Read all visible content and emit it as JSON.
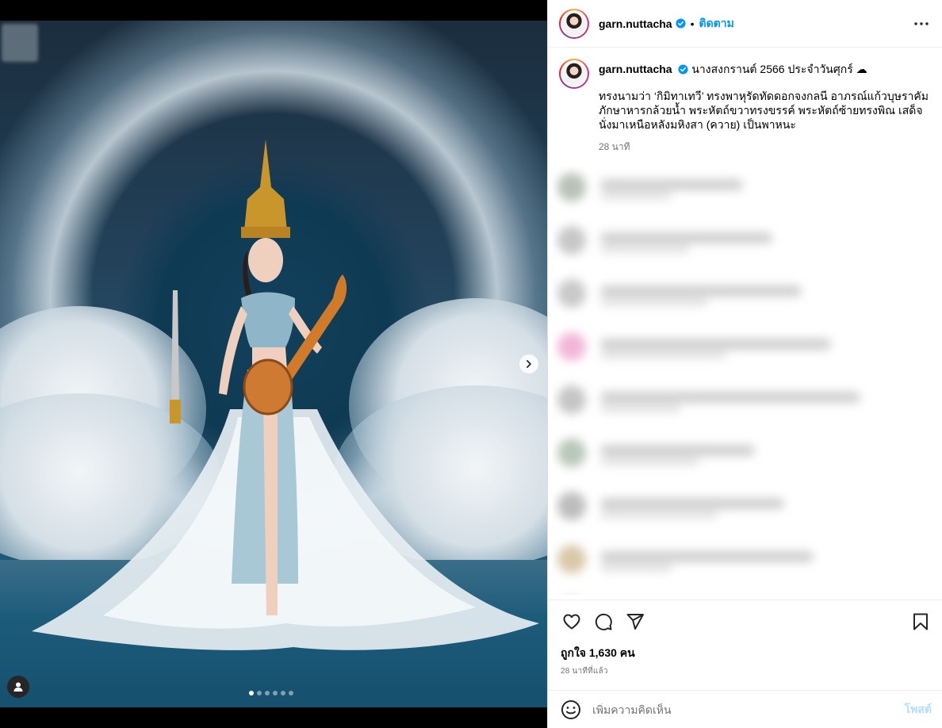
{
  "post": {
    "username": "garn.nuttacha",
    "follow_label": "ติดตาม",
    "separator": "•",
    "caption_title": "นางสงกรานต์ 2566 ประจำวันศุกร์ ☁",
    "caption_text": "ทรงนามว่า ‘กิมิทาเทวี’ ทรงพาหุรัดทัดดอกจงกลนี อาภรณ์แก้วบุษราคัม ภักษาหารกล้วยน้ำ พระหัตถ์ขวาทรงขรรค์ พระหัตถ์ซ้ายทรงพิณ เสด็จนั่งมาเหนือหลังมหิงสา (ควาย) เป็นพาหนะ",
    "caption_time": "28 นาที",
    "likes_label": "ถูกใจ 1,630 คน",
    "posted_ago": "28 นาทีที่แล้ว"
  },
  "comment_box": {
    "placeholder": "เพิ่มความคิดเห็น",
    "post_label": "โพสต์"
  },
  "carousel": {
    "slide_count": 6,
    "active_index": 0
  },
  "colors": {
    "accent": "#0095f6",
    "post_disabled": "#b2dffc",
    "muted": "#737373",
    "verified": "#0095f6"
  },
  "icons": {
    "more": "more-icon",
    "like": "heart-icon",
    "comment": "comment-icon",
    "share": "share-icon",
    "save": "bookmark-icon",
    "emoji": "emoji-icon",
    "next": "chevron-right-icon",
    "user_tag": "user-icon"
  }
}
